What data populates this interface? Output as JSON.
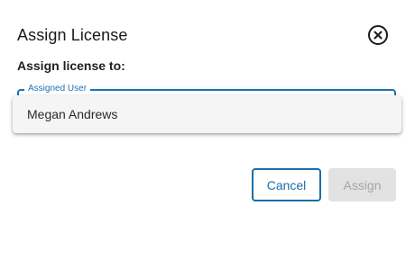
{
  "dialog": {
    "title": "Assign License",
    "subtitle": "Assign license to:",
    "close_icon": "close-circle-icon"
  },
  "field": {
    "label": "Assigned User",
    "accent_color": "#1a73b8"
  },
  "dropdown": {
    "options": [
      "Megan Andrews"
    ]
  },
  "actions": {
    "cancel_label": "Cancel",
    "assign_label": "Assign",
    "assign_disabled": true
  }
}
